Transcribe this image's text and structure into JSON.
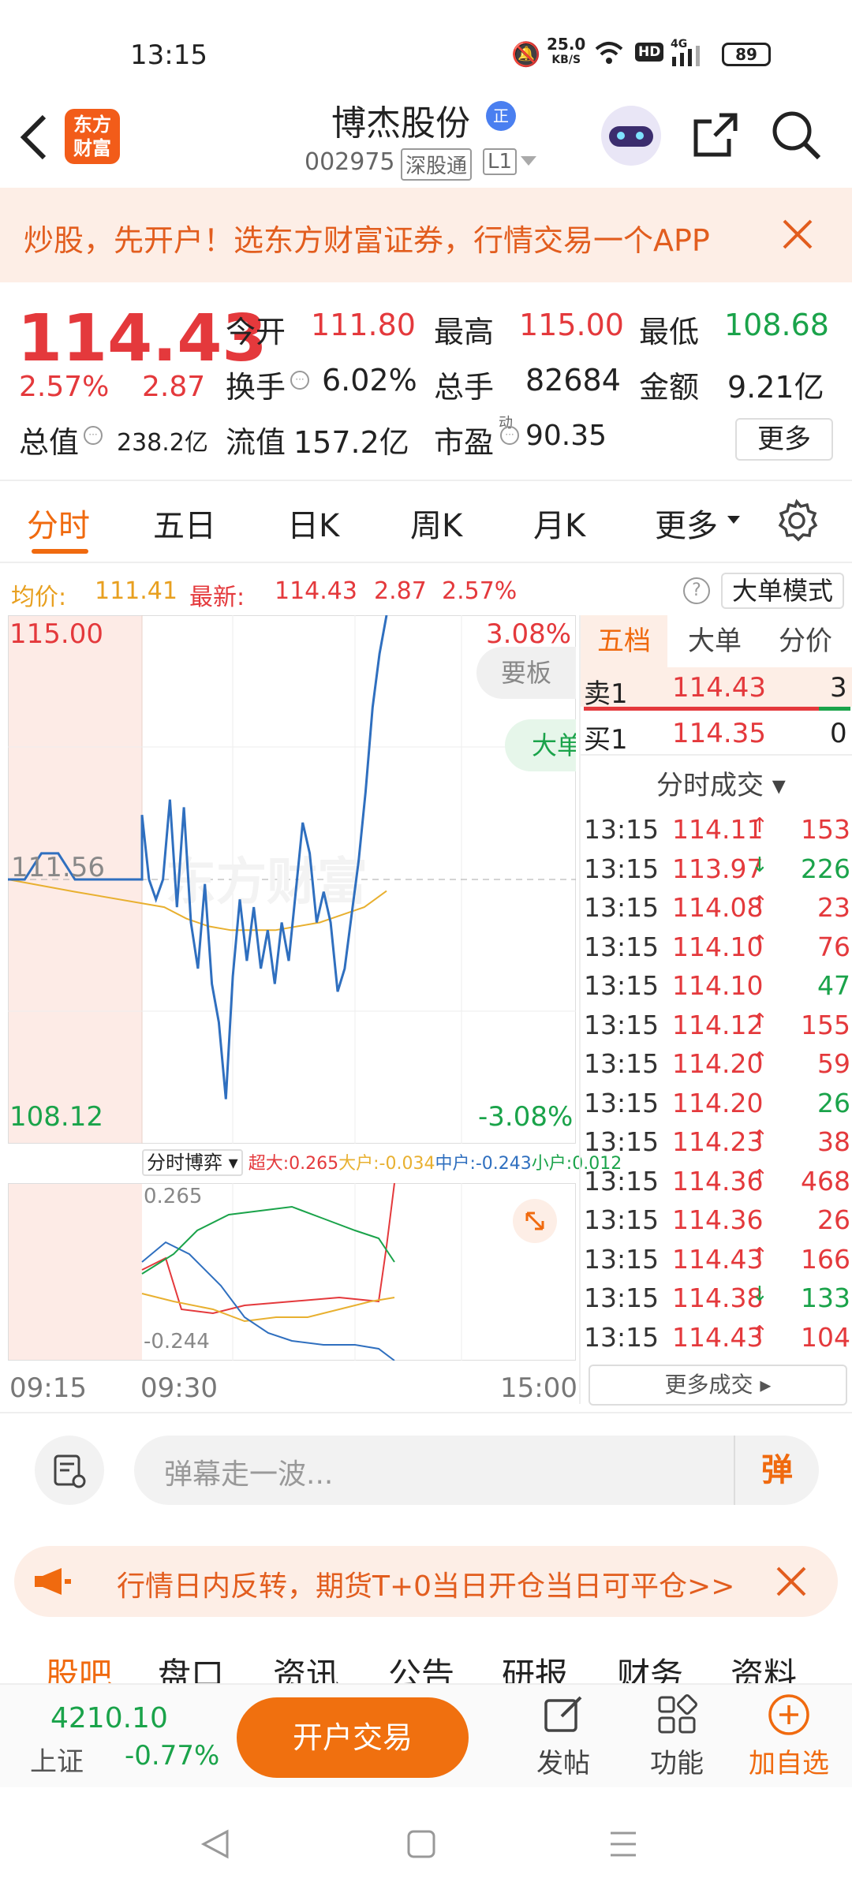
{
  "status": {
    "time": "13:15",
    "speed": "25.0",
    "speed_unit": "KB/S",
    "hd": "HD",
    "net": "4G",
    "battery": "89"
  },
  "header": {
    "logo": "东方财富",
    "stock_name": "博杰股份",
    "badge": "正",
    "code": "002975",
    "tag1": "深股通",
    "tag2": "L1"
  },
  "banner": {
    "text": "炒股，先开户！选东方财富证券，行情交易一个APP"
  },
  "quote": {
    "price": "114.43",
    "pct": "2.57%",
    "change": "2.87",
    "open_label": "今开",
    "open": "111.80",
    "high_label": "最高",
    "high": "115.00",
    "low_label": "最低",
    "low": "108.68",
    "turnover_label": "换手",
    "turnover": "6.02%",
    "volume_label": "总手",
    "volume": "82684",
    "amount_label": "金额",
    "amount": "9.21亿",
    "cap_label": "总值",
    "cap": "238.2亿",
    "float_label": "流值",
    "float": "157.2亿",
    "pe_label": "市盈",
    "pe_sup": "动",
    "pe": "90.35",
    "more": "更多"
  },
  "tabs": {
    "items": [
      "分时",
      "五日",
      "日K",
      "周K",
      "月K",
      "更多"
    ]
  },
  "info": {
    "avg_label": "均价:",
    "avg": "111.41",
    "latest_label": "最新:",
    "latest": "114.43",
    "change": "2.87",
    "pct": "2.57%",
    "mode": "大单模式"
  },
  "chart_labels": {
    "high": "115.00",
    "low": "108.12",
    "mid": "111.56",
    "pct_up": "3.08%",
    "pct_down": "-3.08%",
    "btn1": "要板",
    "btn2": "大单",
    "watermark": "东方财富",
    "game_label": "分时博弈",
    "legend": {
      "a_label": "超大:",
      "a": "0.265",
      "b_label": "大户:",
      "b": "-0.034",
      "c_label": "中户:",
      "c": "-0.243",
      "d_label": "小户:",
      "d": "0.012"
    },
    "sub_top": "0.265",
    "sub_bottom": "-0.244",
    "t1": "09:15",
    "t2": "09:30",
    "t3": "15:00"
  },
  "chart_data": {
    "type": "line",
    "price": [
      111.56,
      111.56,
      111.9,
      111.9,
      111.56,
      111.56,
      111.56,
      111.56,
      111.56,
      112.4,
      111.56,
      111.3,
      111.56,
      112.6,
      111.2,
      112.5,
      111.0,
      110.4,
      111.5,
      110.2,
      109.7,
      108.7,
      110.3,
      111.3,
      110.5,
      111.2,
      110.4,
      110.9,
      110.2,
      111.0,
      110.5,
      111.4,
      112.3,
      111.9,
      111.0,
      111.4,
      111.0,
      110.1,
      110.4,
      111.1,
      111.8,
      112.7,
      113.8,
      114.5,
      115.0
    ],
    "avg": [
      111.56,
      111.4,
      111.2,
      111.05,
      110.95,
      110.9,
      110.9,
      110.9,
      110.95,
      111.0,
      111.1,
      111.2,
      111.41
    ],
    "ylim": [
      108.12,
      115.0
    ],
    "xticks": [
      "09:15",
      "09:30",
      "15:00"
    ]
  },
  "panel": {
    "tabs": [
      "五档",
      "大单",
      "分价"
    ],
    "sell_label": "卖1",
    "sell_price": "114.43",
    "sell_vol": "3",
    "buy_label": "买1",
    "buy_price": "114.35",
    "buy_vol": "0",
    "trades_title": "分时成交",
    "more_trades": "更多成交",
    "trades": [
      {
        "t": "13:15",
        "p": "114.11",
        "a": "↑",
        "v": "153",
        "c": "red",
        "vc": "red"
      },
      {
        "t": "13:15",
        "p": "113.97",
        "a": "↓",
        "v": "226",
        "c": "red",
        "vc": "green"
      },
      {
        "t": "13:15",
        "p": "114.08",
        "a": "↑",
        "v": "23",
        "c": "red",
        "vc": "red"
      },
      {
        "t": "13:15",
        "p": "114.10",
        "a": "↑",
        "v": "76",
        "c": "red",
        "vc": "red"
      },
      {
        "t": "13:15",
        "p": "114.10",
        "a": "",
        "v": "47",
        "c": "red",
        "vc": "green"
      },
      {
        "t": "13:15",
        "p": "114.12",
        "a": "↑",
        "v": "155",
        "c": "red",
        "vc": "red"
      },
      {
        "t": "13:15",
        "p": "114.20",
        "a": "↑",
        "v": "59",
        "c": "red",
        "vc": "red"
      },
      {
        "t": "13:15",
        "p": "114.20",
        "a": "",
        "v": "26",
        "c": "red",
        "vc": "green"
      },
      {
        "t": "13:15",
        "p": "114.23",
        "a": "↑",
        "v": "38",
        "c": "red",
        "vc": "red"
      },
      {
        "t": "13:15",
        "p": "114.36",
        "a": "↑",
        "v": "468",
        "c": "red",
        "vc": "red"
      },
      {
        "t": "13:15",
        "p": "114.36",
        "a": "",
        "v": "26",
        "c": "red",
        "vc": "red"
      },
      {
        "t": "13:15",
        "p": "114.43",
        "a": "↑",
        "v": "166",
        "c": "red",
        "vc": "red"
      },
      {
        "t": "13:15",
        "p": "114.38",
        "a": "↓",
        "v": "133",
        "c": "red",
        "vc": "green"
      },
      {
        "t": "13:15",
        "p": "114.43",
        "a": "↑",
        "v": "104",
        "c": "red",
        "vc": "red"
      }
    ]
  },
  "comment": {
    "placeholder": "弹幕走一波...",
    "send": "弹"
  },
  "notice": {
    "text": "行情日内反转，期货T+0当日开仓当日可平仓>>"
  },
  "subtabs": {
    "items": [
      "股吧",
      "盘口",
      "资讯",
      "公告",
      "研报",
      "财务",
      "资料"
    ]
  },
  "bottom": {
    "index_value": "4210.10",
    "index_name": "上证",
    "index_pct": "-0.77%",
    "trade_btn": "开户交易",
    "post": "发帖",
    "func": "功能",
    "add": "加自选"
  }
}
